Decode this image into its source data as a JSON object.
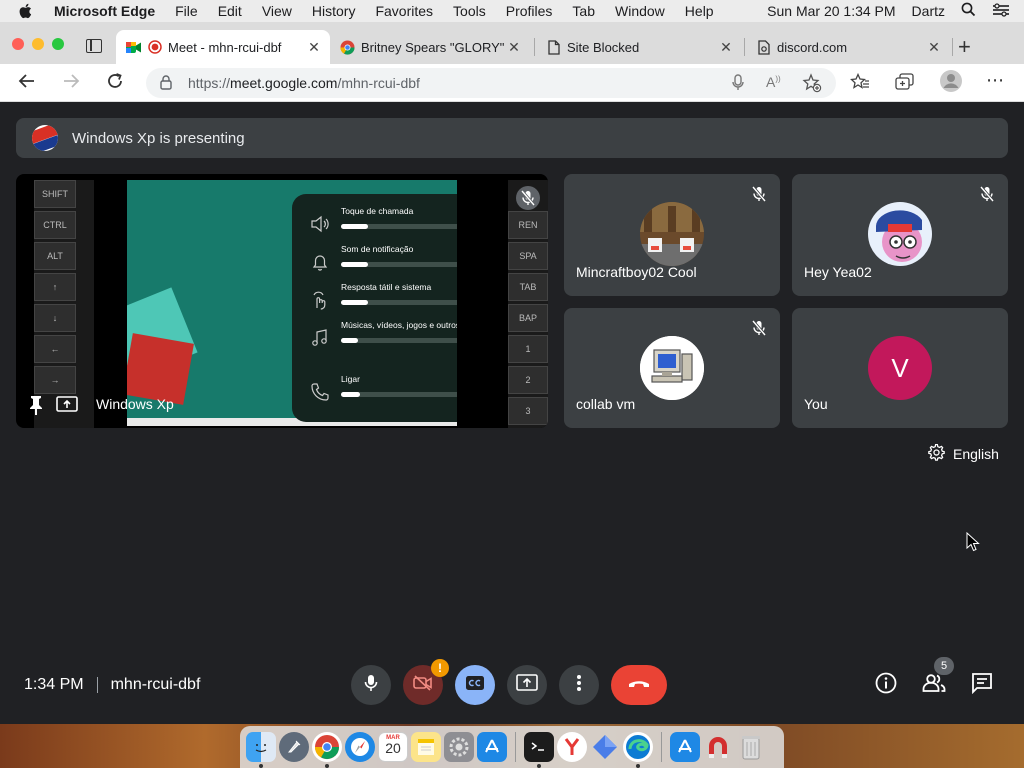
{
  "menubar": {
    "app_name": "Microsoft Edge",
    "items": [
      "File",
      "Edit",
      "View",
      "History",
      "Favorites",
      "Tools",
      "Profiles",
      "Tab",
      "Window",
      "Help"
    ],
    "clock": "Sun Mar 20  1:34 PM",
    "user": "Dartz"
  },
  "browser": {
    "tabs": [
      {
        "label": "Meet - mhn-rcui-dbf",
        "active": true
      },
      {
        "label": "Britney Spears \"GLORY\"",
        "active": false
      },
      {
        "label": "Site Blocked",
        "active": false
      },
      {
        "label": "discord.com",
        "active": false
      }
    ],
    "url_prefix": "https://",
    "url_domain": "meet.google.com",
    "url_path": "/mhn-rcui-dbf"
  },
  "meet": {
    "presenting_text": "Windows Xp is presenting",
    "shared_screen": {
      "presenter_name": "Windows Xp",
      "keys_left": [
        "SHIFT",
        "CTRL",
        "ALT",
        "↑",
        "↓",
        "←",
        "→"
      ],
      "keys_right": [
        "",
        "REN",
        "SPA",
        "TAB",
        "BAP",
        "1",
        "2",
        "3"
      ],
      "volume_rows": [
        {
          "label": "Toque de chamada",
          "level": 0.2,
          "icon": "speaker-icon"
        },
        {
          "label": "Som de notificação",
          "level": 0.2,
          "icon": "bell-icon"
        },
        {
          "label": "Resposta tátil e sistema",
          "level": 0.2,
          "icon": "vibrate-icon"
        },
        {
          "label": "Músicas, vídeos, jogos e outros...",
          "level": 0.13,
          "icon": "music-icon"
        },
        {
          "label": "Ligar",
          "level": 0.14,
          "icon": "phone-icon"
        }
      ]
    },
    "participants": [
      {
        "name": "Mincraftboy02 Cool",
        "muted": true
      },
      {
        "name": "Hey Yea02",
        "muted": true
      },
      {
        "name": "collab vm",
        "muted": true
      },
      {
        "name": "You",
        "muted": false,
        "initial": "V",
        "avatar_color": "#c2185b"
      }
    ],
    "language": "English",
    "time": "1:34 PM",
    "meeting_code": "mhn-rcui-dbf",
    "camera_warning": "!",
    "people_count": "5"
  },
  "dock": {
    "calendar_day": "20",
    "calendar_month": "MAR"
  }
}
